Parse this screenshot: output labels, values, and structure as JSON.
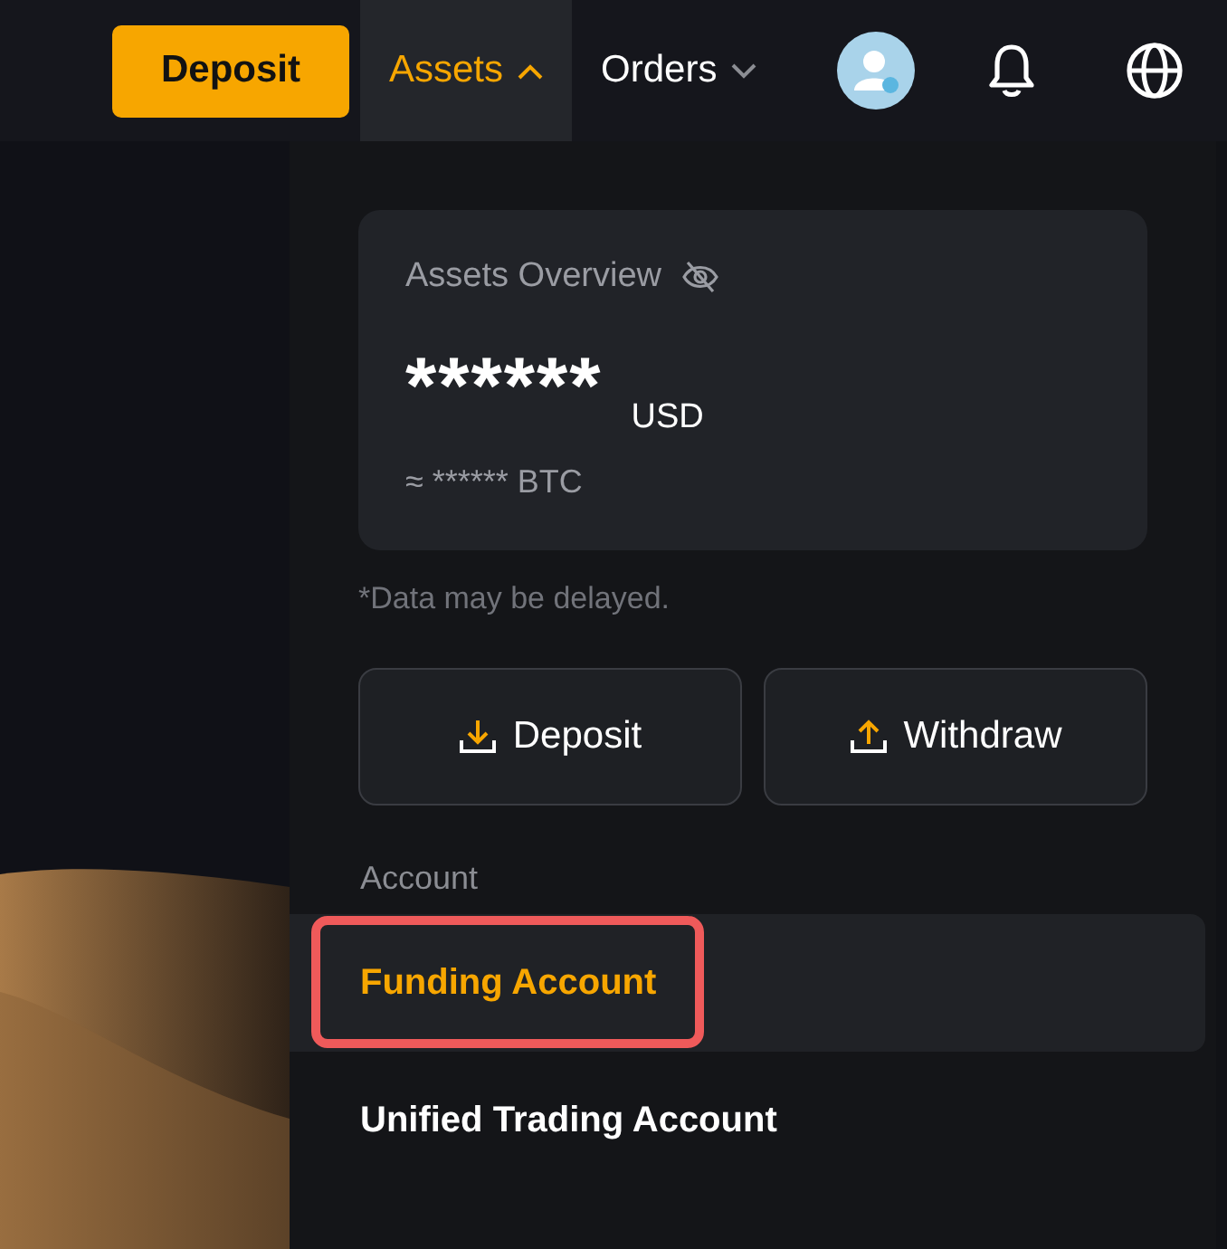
{
  "nav": {
    "deposit_button": "Deposit",
    "menus": [
      {
        "label": "Assets",
        "selected": true,
        "expanded": true
      },
      {
        "label": "Orders",
        "selected": false,
        "expanded": false
      }
    ]
  },
  "assets_panel": {
    "overview": {
      "title": "Assets Overview",
      "balance": "******",
      "currency": "USD",
      "btc_equivalent": "≈ ****** BTC"
    },
    "note": "*Data may be delayed.",
    "actions": [
      {
        "label": "Deposit",
        "kind": "deposit"
      },
      {
        "label": "Withdraw",
        "kind": "withdraw"
      }
    ],
    "account_heading": "Account",
    "accounts": [
      {
        "label": "Funding Account",
        "selected": true,
        "highlighted": true
      },
      {
        "label": "Unified Trading Account",
        "selected": false,
        "highlighted": false
      }
    ]
  }
}
